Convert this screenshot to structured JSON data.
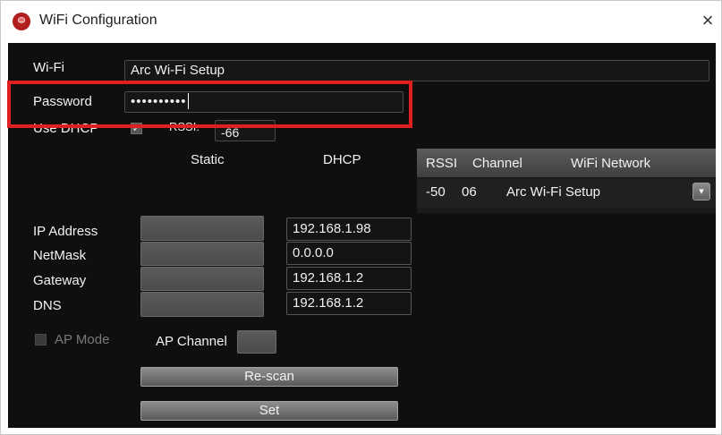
{
  "window": {
    "title": "WiFi Configuration",
    "close_glyph": "×",
    "app_icon": "app-icon"
  },
  "form": {
    "wifi_label": "Wi-Fi",
    "wifi_value": "Arc Wi-Fi Setup",
    "password_label": "Password",
    "password_value": "••••••••••",
    "use_dhcp_label": "Use DHCP",
    "use_dhcp_checked": true,
    "rssi_label": "RSSI:",
    "rssi_value": "-66",
    "static_header": "Static",
    "dhcp_header": "DHCP",
    "ip_label": "IP Address",
    "netmask_label": "NetMask",
    "gateway_label": "Gateway",
    "dns_label": "DNS",
    "static": {
      "ip": "",
      "netmask": "",
      "gateway": "",
      "dns": ""
    },
    "dhcp": {
      "ip": "192.168.1.98",
      "netmask": "0.0.0.0",
      "gateway": "192.168.1.2",
      "dns": "192.168.1.2"
    },
    "ap_mode_label": "AP Mode",
    "ap_mode_checked": false,
    "ap_channel_label": "AP Channel",
    "ap_channel_value": ""
  },
  "network_list": {
    "columns": [
      "RSSI",
      "Channel",
      "WiFi Network"
    ],
    "rows": [
      {
        "rssi": "-50",
        "channel": "06",
        "network": "Arc Wi-Fi Setup"
      }
    ],
    "dropdown_glyph": "▾"
  },
  "buttons": {
    "rescan": "Re-scan",
    "set": "Set"
  },
  "highlight": {
    "color": "#e02020"
  }
}
